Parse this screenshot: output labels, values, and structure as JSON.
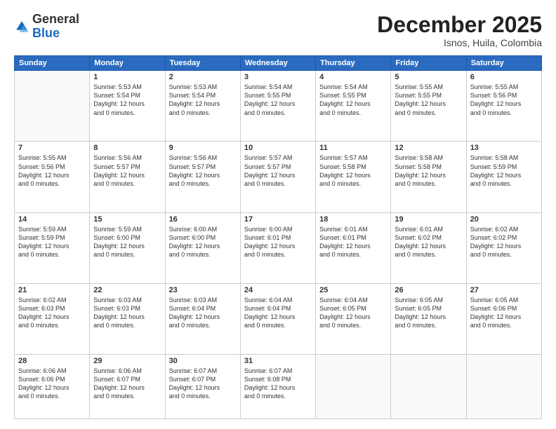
{
  "logo": {
    "general": "General",
    "blue": "Blue"
  },
  "header": {
    "month": "December 2025",
    "location": "Isnos, Huila, Colombia"
  },
  "weekdays": [
    "Sunday",
    "Monday",
    "Tuesday",
    "Wednesday",
    "Thursday",
    "Friday",
    "Saturday"
  ],
  "weeks": [
    [
      {
        "day": "",
        "info": ""
      },
      {
        "day": "1",
        "info": "Sunrise: 5:53 AM\nSunset: 5:54 PM\nDaylight: 12 hours\nand 0 minutes."
      },
      {
        "day": "2",
        "info": "Sunrise: 5:53 AM\nSunset: 5:54 PM\nDaylight: 12 hours\nand 0 minutes."
      },
      {
        "day": "3",
        "info": "Sunrise: 5:54 AM\nSunset: 5:55 PM\nDaylight: 12 hours\nand 0 minutes."
      },
      {
        "day": "4",
        "info": "Sunrise: 5:54 AM\nSunset: 5:55 PM\nDaylight: 12 hours\nand 0 minutes."
      },
      {
        "day": "5",
        "info": "Sunrise: 5:55 AM\nSunset: 5:55 PM\nDaylight: 12 hours\nand 0 minutes."
      },
      {
        "day": "6",
        "info": "Sunrise: 5:55 AM\nSunset: 5:56 PM\nDaylight: 12 hours\nand 0 minutes."
      }
    ],
    [
      {
        "day": "7",
        "info": "Sunrise: 5:55 AM\nSunset: 5:56 PM\nDaylight: 12 hours\nand 0 minutes."
      },
      {
        "day": "8",
        "info": "Sunrise: 5:56 AM\nSunset: 5:57 PM\nDaylight: 12 hours\nand 0 minutes."
      },
      {
        "day": "9",
        "info": "Sunrise: 5:56 AM\nSunset: 5:57 PM\nDaylight: 12 hours\nand 0 minutes."
      },
      {
        "day": "10",
        "info": "Sunrise: 5:57 AM\nSunset: 5:57 PM\nDaylight: 12 hours\nand 0 minutes."
      },
      {
        "day": "11",
        "info": "Sunrise: 5:57 AM\nSunset: 5:58 PM\nDaylight: 12 hours\nand 0 minutes."
      },
      {
        "day": "12",
        "info": "Sunrise: 5:58 AM\nSunset: 5:58 PM\nDaylight: 12 hours\nand 0 minutes."
      },
      {
        "day": "13",
        "info": "Sunrise: 5:58 AM\nSunset: 5:59 PM\nDaylight: 12 hours\nand 0 minutes."
      }
    ],
    [
      {
        "day": "14",
        "info": "Sunrise: 5:59 AM\nSunset: 5:59 PM\nDaylight: 12 hours\nand 0 minutes."
      },
      {
        "day": "15",
        "info": "Sunrise: 5:59 AM\nSunset: 6:00 PM\nDaylight: 12 hours\nand 0 minutes."
      },
      {
        "day": "16",
        "info": "Sunrise: 6:00 AM\nSunset: 6:00 PM\nDaylight: 12 hours\nand 0 minutes."
      },
      {
        "day": "17",
        "info": "Sunrise: 6:00 AM\nSunset: 6:01 PM\nDaylight: 12 hours\nand 0 minutes."
      },
      {
        "day": "18",
        "info": "Sunrise: 6:01 AM\nSunset: 6:01 PM\nDaylight: 12 hours\nand 0 minutes."
      },
      {
        "day": "19",
        "info": "Sunrise: 6:01 AM\nSunset: 6:02 PM\nDaylight: 12 hours\nand 0 minutes."
      },
      {
        "day": "20",
        "info": "Sunrise: 6:02 AM\nSunset: 6:02 PM\nDaylight: 12 hours\nand 0 minutes."
      }
    ],
    [
      {
        "day": "21",
        "info": "Sunrise: 6:02 AM\nSunset: 6:03 PM\nDaylight: 12 hours\nand 0 minutes."
      },
      {
        "day": "22",
        "info": "Sunrise: 6:03 AM\nSunset: 6:03 PM\nDaylight: 12 hours\nand 0 minutes."
      },
      {
        "day": "23",
        "info": "Sunrise: 6:03 AM\nSunset: 6:04 PM\nDaylight: 12 hours\nand 0 minutes."
      },
      {
        "day": "24",
        "info": "Sunrise: 6:04 AM\nSunset: 6:04 PM\nDaylight: 12 hours\nand 0 minutes."
      },
      {
        "day": "25",
        "info": "Sunrise: 6:04 AM\nSunset: 6:05 PM\nDaylight: 12 hours\nand 0 minutes."
      },
      {
        "day": "26",
        "info": "Sunrise: 6:05 AM\nSunset: 6:05 PM\nDaylight: 12 hours\nand 0 minutes."
      },
      {
        "day": "27",
        "info": "Sunrise: 6:05 AM\nSunset: 6:06 PM\nDaylight: 12 hours\nand 0 minutes."
      }
    ],
    [
      {
        "day": "28",
        "info": "Sunrise: 6:06 AM\nSunset: 6:06 PM\nDaylight: 12 hours\nand 0 minutes."
      },
      {
        "day": "29",
        "info": "Sunrise: 6:06 AM\nSunset: 6:07 PM\nDaylight: 12 hours\nand 0 minutes."
      },
      {
        "day": "30",
        "info": "Sunrise: 6:07 AM\nSunset: 6:07 PM\nDaylight: 12 hours\nand 0 minutes."
      },
      {
        "day": "31",
        "info": "Sunrise: 6:07 AM\nSunset: 6:08 PM\nDaylight: 12 hours\nand 0 minutes."
      },
      {
        "day": "",
        "info": ""
      },
      {
        "day": "",
        "info": ""
      },
      {
        "day": "",
        "info": ""
      }
    ]
  ]
}
